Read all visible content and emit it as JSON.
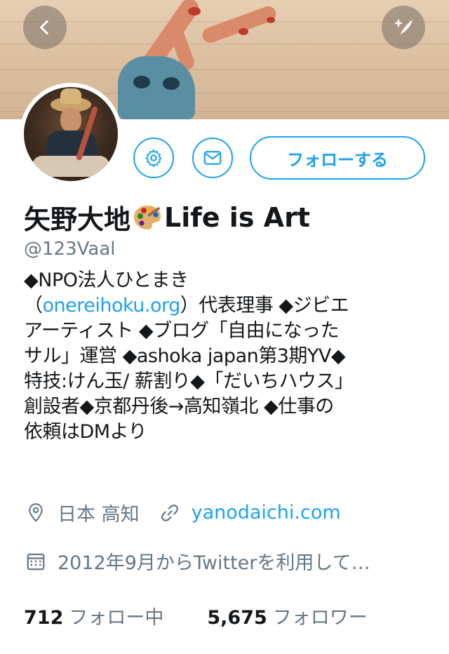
{
  "profile": {
    "display_name": "矢野大地",
    "name_emoji": "artist-palette-emoji",
    "name_suffix": "Life is Art",
    "handle": "@123Vaal",
    "follow_label": "フォローする"
  },
  "bio": {
    "line1": "◆NPO法人ひとまき",
    "line2_open": "（",
    "line2_link": "onereihoku.org",
    "line2_rest": "）代表理事 ◆ジビエ",
    "line3": "アーティスト ◆ブログ「自由になった",
    "line4": "サル」運営 ◆ashoka japan第3期YV◆",
    "line5": "特技:けん玉/ 薪割り◆「だいちハウス」",
    "line6": "創設者◆京都丹後→高知嶺北 ◆仕事の",
    "line7": "依頼はDMより"
  },
  "meta": {
    "location": "日本 高知",
    "website": "yanodaichi.com",
    "joined": "2012年9月からTwitterを利用して…"
  },
  "stats": {
    "following_count": "712",
    "following_label": "フォロー中",
    "followers_count": "5,675",
    "followers_label": "フォロワー"
  },
  "colors": {
    "accent": "#1da1f2",
    "secondary_text": "#657786",
    "primary_text": "#14171a"
  },
  "icons": [
    "back-icon",
    "compose-tweet-icon",
    "settings-gear-icon",
    "message-envelope-icon",
    "location-pin-icon",
    "link-icon",
    "calendar-icon"
  ]
}
